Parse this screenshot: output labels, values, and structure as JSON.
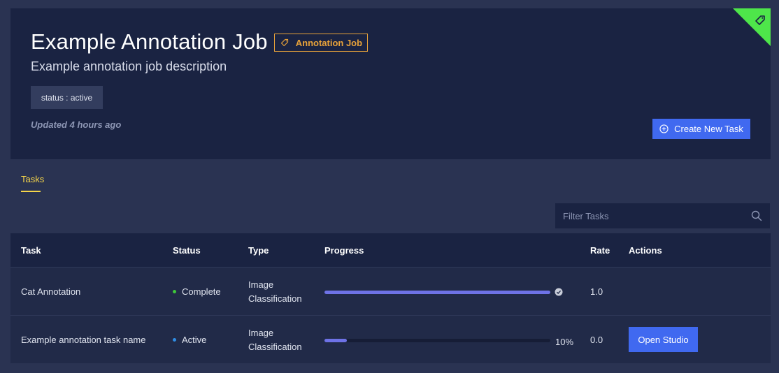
{
  "header": {
    "title": "Example Annotation Job",
    "badge": "Annotation Job",
    "description": "Example annotation job description",
    "status_chip": "status : active",
    "updated": "Updated 4 hours ago",
    "create_button": "Create New Task",
    "corner_icon": "tag-icon"
  },
  "tabs": [
    {
      "label": "Tasks",
      "active": true
    }
  ],
  "filter": {
    "placeholder": "Filter Tasks",
    "value": ""
  },
  "table": {
    "columns": [
      "Task",
      "Status",
      "Type",
      "Progress",
      "Rate",
      "Actions"
    ],
    "rows": [
      {
        "task": "Cat Annotation",
        "status": "Complete",
        "status_color": "#3ec93a",
        "type_line1": "Image",
        "type_line2": "Classification",
        "progress": 1.0,
        "progress_label": "",
        "rate": "1.0",
        "action": ""
      },
      {
        "task": "Example annotation task name",
        "status": "Active",
        "status_color": "#2f8de4",
        "type_line1": "Image",
        "type_line2": "Classification",
        "progress": 0.1,
        "progress_label": "10%",
        "rate": "0.0",
        "action": "Open Studio"
      }
    ]
  },
  "colors": {
    "accent": "#4069f0",
    "badge": "#e7a23a",
    "tab_active": "#f5d54a",
    "corner": "#4ee64a",
    "link": "#5aa2ef",
    "progress": "#6e72e6"
  }
}
